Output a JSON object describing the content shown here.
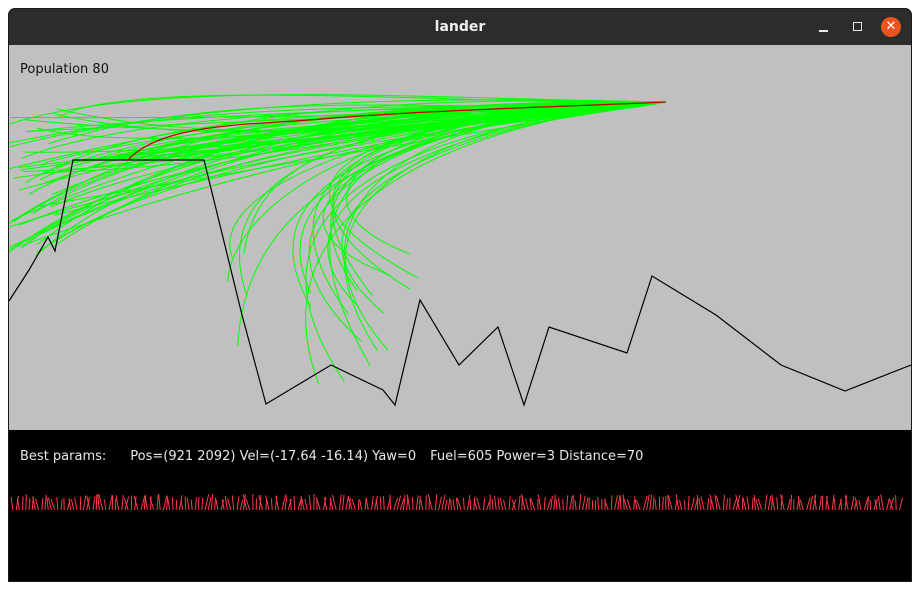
{
  "window": {
    "title": "lander"
  },
  "controls": {
    "minimize_icon": "minimize-icon",
    "maximize_icon": "maximize-icon",
    "close_icon": "close-icon",
    "close_glyph": "✕"
  },
  "sim": {
    "population_label": "Population 80"
  },
  "params": {
    "label": "Best params:",
    "pos_vel_yaw": "Pos=(921 2092) Vel=(-17.64 -16.14) Yaw=0",
    "fuel_power_distance": "Fuel=605 Power=3 Distance=70"
  },
  "colors": {
    "sky": "#c0c0c0",
    "terrain": "#000000",
    "trajectory": "#00ff00",
    "best_trajectory": "#c00000",
    "genes": "#ff3a4a",
    "panel": "#000000",
    "close_button": "#e9541f"
  }
}
